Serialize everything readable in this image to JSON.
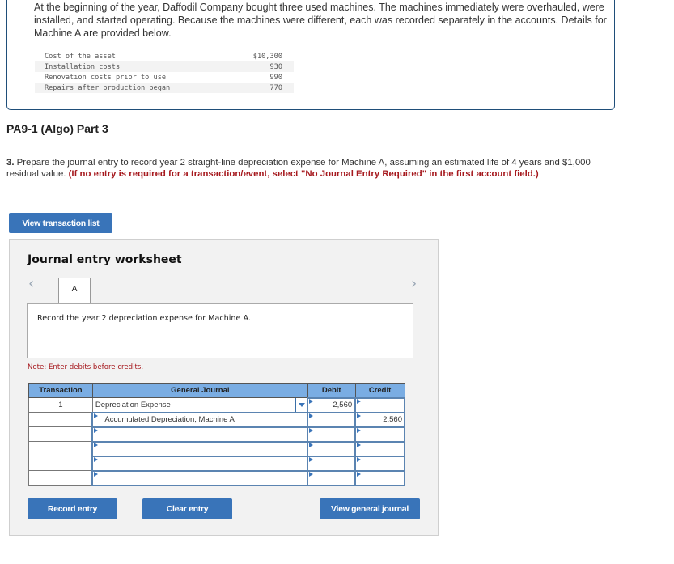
{
  "intro": {
    "text": "At the beginning of the year, Daffodil Company bought three used machines. The machines immediately were overhauled, were installed, and started operating. Because the machines were different, each was recorded separately in the accounts. Details for Machine A are provided below.",
    "asset_rows": [
      {
        "label": "Cost of the asset",
        "value": "$10,300"
      },
      {
        "label": "Installation costs",
        "value": "930"
      },
      {
        "label": "Renovation costs prior to use",
        "value": "990"
      },
      {
        "label": "Repairs after production began",
        "value": "770"
      }
    ]
  },
  "part_title": "PA9-1 (Algo) Part 3",
  "question": {
    "number": "3.",
    "text": " Prepare the journal entry to record year 2 straight-line depreciation expense for Machine A, assuming an estimated life of 4 years and $1,000 residual value. ",
    "warning": "(If no entry is required for a transaction/event, select \"No Journal Entry Required\" in the first account field.)"
  },
  "buttons": {
    "view_transaction_list": "View transaction list",
    "record_entry": "Record entry",
    "clear_entry": "Clear entry",
    "view_general_journal": "View general journal"
  },
  "worksheet": {
    "title": "Journal entry worksheet",
    "prev_icon": "‹",
    "next_icon": "›",
    "tab_label": "A",
    "description": "Record the year 2 depreciation expense for Machine A.",
    "note": "Note: Enter debits before credits.",
    "columns": [
      "Transaction",
      "General Journal",
      "Debit",
      "Credit"
    ],
    "rows": [
      {
        "transaction": "1",
        "account": "Depreciation Expense",
        "debit": "2,560",
        "credit": ""
      },
      {
        "transaction": "",
        "account": "Accumulated Depreciation, Machine A",
        "debit": "",
        "credit": "2,560"
      },
      {
        "transaction": "",
        "account": "",
        "debit": "",
        "credit": ""
      },
      {
        "transaction": "",
        "account": "",
        "debit": "",
        "credit": ""
      },
      {
        "transaction": "",
        "account": "",
        "debit": "",
        "credit": ""
      },
      {
        "transaction": "",
        "account": "",
        "debit": "",
        "credit": ""
      }
    ]
  },
  "colors": {
    "accent_blue": "#3974b9",
    "header_blue": "#7aade3",
    "warning_red": "#a6191e"
  }
}
